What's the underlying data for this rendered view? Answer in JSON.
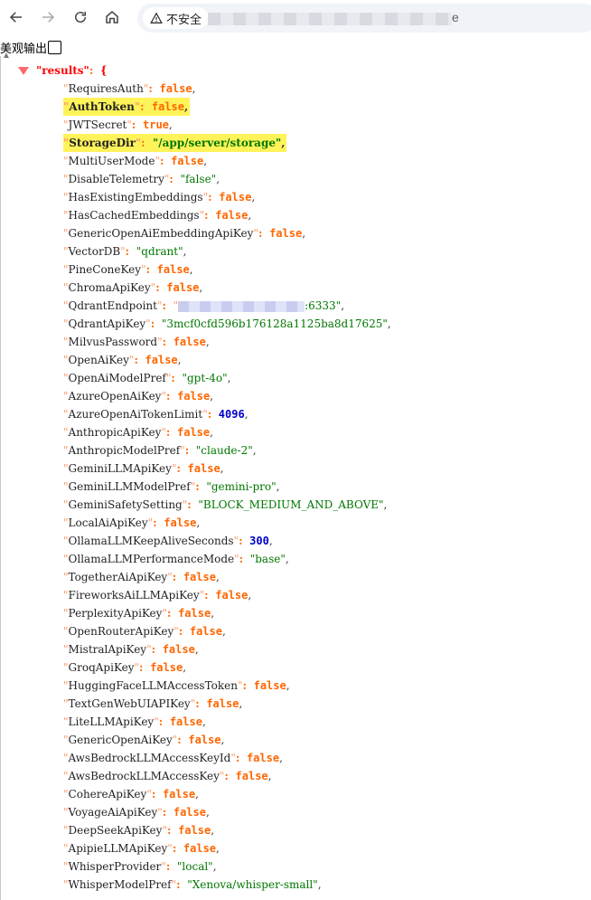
{
  "browser": {
    "security_label": "不安全",
    "url_tail": "e"
  },
  "viewer": {
    "pretty_label": "美观输出"
  },
  "json": {
    "root_key": "\"results\"",
    "root_colon": ":",
    "root_brace": "{",
    "rows": [
      {
        "key": "RequiresAuth",
        "type": "bool",
        "value": "false"
      },
      {
        "key": "AuthToken",
        "type": "bool",
        "value": "false",
        "hl": true
      },
      {
        "key": "JWTSecret",
        "type": "bool",
        "value": "true"
      },
      {
        "key": "StorageDir",
        "type": "str",
        "value": "\"/app/server/storage\"",
        "hl": true
      },
      {
        "key": "MultiUserMode",
        "type": "bool",
        "value": "false"
      },
      {
        "key": "DisableTelemetry",
        "type": "str",
        "value": "\"false\""
      },
      {
        "key": "HasExistingEmbeddings",
        "type": "bool",
        "value": "false"
      },
      {
        "key": "HasCachedEmbeddings",
        "type": "bool",
        "value": "false"
      },
      {
        "key": "GenericOpenAiEmbeddingApiKey",
        "type": "bool",
        "value": "false"
      },
      {
        "key": "VectorDB",
        "type": "str",
        "value": "\"qdrant\""
      },
      {
        "key": "PineConeKey",
        "type": "bool",
        "value": "false"
      },
      {
        "key": "ChromaApiKey",
        "type": "bool",
        "value": "false"
      },
      {
        "key": "QdrantEndpoint",
        "type": "masked",
        "value": ":6333\""
      },
      {
        "key": "QdrantApiKey",
        "type": "str",
        "value": "\"3mcf0cfd596b176128a1125ba8d17625\""
      },
      {
        "key": "MilvusPassword",
        "type": "bool",
        "value": "false"
      },
      {
        "key": "OpenAiKey",
        "type": "bool",
        "value": "false"
      },
      {
        "key": "OpenAiModelPref",
        "type": "str",
        "value": "\"gpt-4o\""
      },
      {
        "key": "AzureOpenAiKey",
        "type": "bool",
        "value": "false"
      },
      {
        "key": "AzureOpenAiTokenLimit",
        "type": "num",
        "value": "4096"
      },
      {
        "key": "AnthropicApiKey",
        "type": "bool",
        "value": "false"
      },
      {
        "key": "AnthropicModelPref",
        "type": "str",
        "value": "\"claude-2\""
      },
      {
        "key": "GeminiLLMApiKey",
        "type": "bool",
        "value": "false"
      },
      {
        "key": "GeminiLLMModelPref",
        "type": "str",
        "value": "\"gemini-pro\""
      },
      {
        "key": "GeminiSafetySetting",
        "type": "str",
        "value": "\"BLOCK_MEDIUM_AND_ABOVE\""
      },
      {
        "key": "LocalAiApiKey",
        "type": "bool",
        "value": "false"
      },
      {
        "key": "OllamaLLMKeepAliveSeconds",
        "type": "num",
        "value": "300"
      },
      {
        "key": "OllamaLLMPerformanceMode",
        "type": "str",
        "value": "\"base\""
      },
      {
        "key": "TogetherAiApiKey",
        "type": "bool",
        "value": "false"
      },
      {
        "key": "FireworksAiLLMApiKey",
        "type": "bool",
        "value": "false"
      },
      {
        "key": "PerplexityApiKey",
        "type": "bool",
        "value": "false"
      },
      {
        "key": "OpenRouterApiKey",
        "type": "bool",
        "value": "false"
      },
      {
        "key": "MistralApiKey",
        "type": "bool",
        "value": "false"
      },
      {
        "key": "GroqApiKey",
        "type": "bool",
        "value": "false"
      },
      {
        "key": "HuggingFaceLLMAccessToken",
        "type": "bool",
        "value": "false"
      },
      {
        "key": "TextGenWebUIAPIKey",
        "type": "bool",
        "value": "false"
      },
      {
        "key": "LiteLLMApiKey",
        "type": "bool",
        "value": "false"
      },
      {
        "key": "GenericOpenAiKey",
        "type": "bool",
        "value": "false"
      },
      {
        "key": "AwsBedrockLLMAccessKeyId",
        "type": "bool",
        "value": "false"
      },
      {
        "key": "AwsBedrockLLMAccessKey",
        "type": "bool",
        "value": "false"
      },
      {
        "key": "CohereApiKey",
        "type": "bool",
        "value": "false"
      },
      {
        "key": "VoyageAiApiKey",
        "type": "bool",
        "value": "false"
      },
      {
        "key": "DeepSeekApiKey",
        "type": "bool",
        "value": "false"
      },
      {
        "key": "ApipieLLMApiKey",
        "type": "bool",
        "value": "false"
      },
      {
        "key": "WhisperProvider",
        "type": "str",
        "value": "\"local\""
      },
      {
        "key": "WhisperModelPref",
        "type": "str",
        "value": "\"Xenova/whisper-small\""
      }
    ]
  }
}
